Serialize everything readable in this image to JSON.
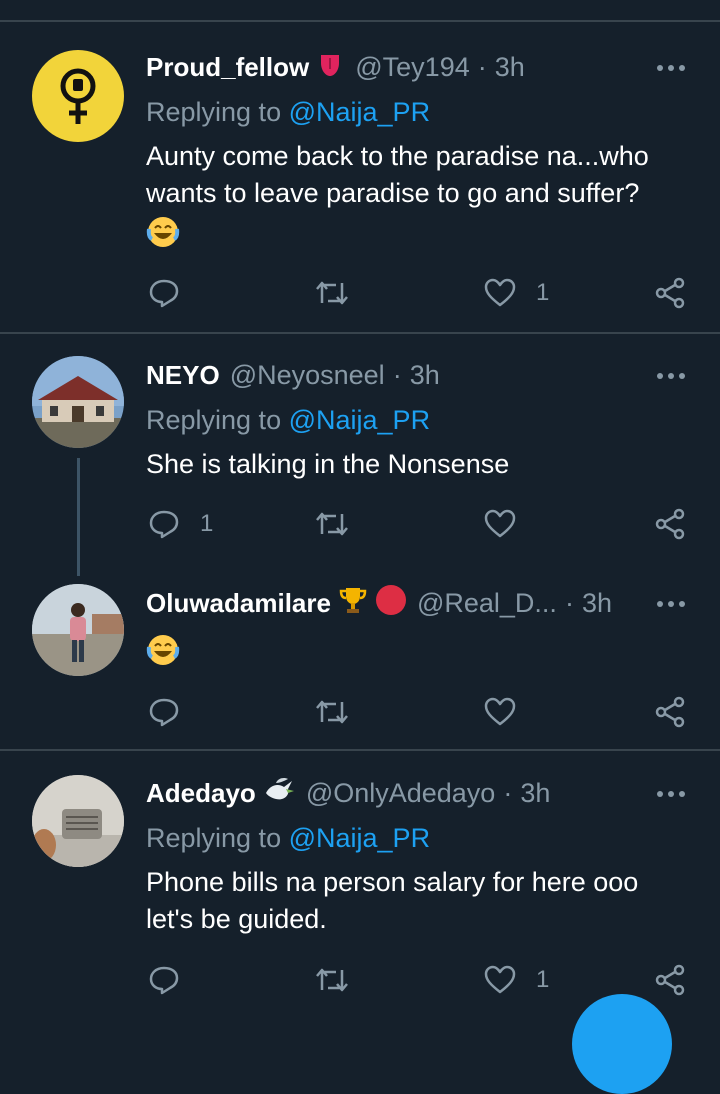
{
  "tweets": [
    {
      "name": "Proud_fellow",
      "badge_icon": "tongue-emoji",
      "handle": "@Tey194",
      "time": "3h",
      "replying_prefix": "Replying to",
      "replying_to": "@Naija_PR",
      "text_lines": [
        "Aunty come back to the paradise na...who",
        "wants to leave paradise to go and suffer?"
      ],
      "emoji": "joy-emoji",
      "reply_count": "",
      "retweet_count": "",
      "like_count": "1"
    },
    {
      "name": "NEYO",
      "handle": "@Neyosneel",
      "time": "3h",
      "replying_prefix": "Replying to",
      "replying_to": "@Naija_PR",
      "text_lines": [
        "She is talking in the Nonsense"
      ],
      "reply_count": "1",
      "retweet_count": "",
      "like_count": ""
    },
    {
      "name": "Oluwadamilare",
      "badge_icons": [
        "trophy-emoji",
        "red-circle-emoji"
      ],
      "handle": "@Real_D...",
      "time": "3h",
      "emoji": "joy-emoji",
      "reply_count": "",
      "retweet_count": "",
      "like_count": ""
    },
    {
      "name": "Adedayo",
      "badge_icon": "dove-emoji",
      "handle": "@OnlyAdedayo",
      "time": "3h",
      "replying_prefix": "Replying to",
      "replying_to": "@Naija_PR",
      "text_lines": [
        "Phone bills na person salary for here ooo",
        "let's be guided."
      ],
      "reply_count": "",
      "retweet_count": "",
      "like_count": "1"
    }
  ],
  "colors": {
    "background": "#15202b",
    "divider": "#38444d",
    "secondary_text": "#8899a6",
    "accent": "#1da1f2"
  }
}
